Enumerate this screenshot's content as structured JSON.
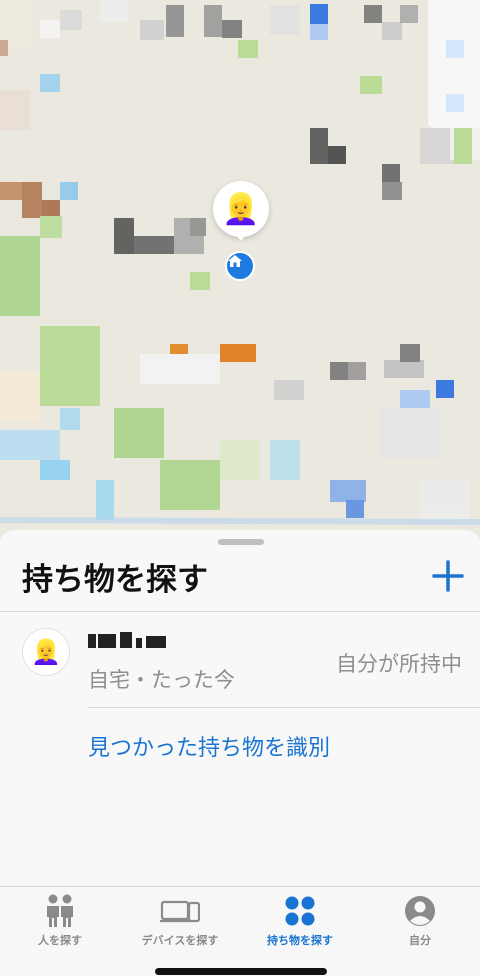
{
  "colors": {
    "accent": "#1a75d2",
    "map_background": "#ebe8e0",
    "sheet_background": "#f8f8f8",
    "secondary_text": "#8e8e8e"
  },
  "map": {
    "pin_avatar_emoji": "👱‍♀️",
    "home_icon": "house-icon"
  },
  "sheet": {
    "title": "持ち物を探す",
    "add_icon": "plus-icon",
    "item": {
      "avatar_emoji": "👱‍♀️",
      "subtitle": "自宅・たった今",
      "status": "自分が所持中"
    },
    "identify_link": "見つかった持ち物を識別"
  },
  "tabbar": {
    "tabs": [
      {
        "label": "人を探す",
        "icon": "people-icon",
        "active": false
      },
      {
        "label": "デバイスを探す",
        "icon": "devices-icon",
        "active": false
      },
      {
        "label": "持ち物を探す",
        "icon": "items-icon",
        "active": true
      },
      {
        "label": "自分",
        "icon": "person-circle-icon",
        "active": false
      }
    ]
  }
}
